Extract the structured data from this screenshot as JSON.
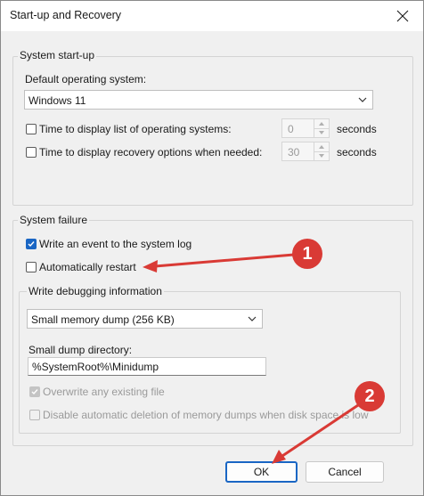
{
  "window": {
    "title": "Start-up and Recovery"
  },
  "startup": {
    "group_label": "System start-up",
    "default_os_label": "Default operating system:",
    "default_os_value": "Windows 11",
    "time_list_label": "Time to display list of operating systems:",
    "time_list_value": "0",
    "time_list_checked": false,
    "time_recovery_label": "Time to display recovery options when needed:",
    "time_recovery_value": "30",
    "time_recovery_checked": false,
    "seconds_label": "seconds"
  },
  "failure": {
    "group_label": "System failure",
    "write_event_label": "Write an event to the system log",
    "write_event_checked": true,
    "auto_restart_label": "Automatically restart",
    "auto_restart_checked": false,
    "debug_group_label": "Write debugging information",
    "debug_select_value": "Small memory dump (256 KB)",
    "dump_dir_label": "Small dump directory:",
    "dump_dir_value": "%SystemRoot%\\Minidump",
    "overwrite_label": "Overwrite any existing file",
    "overwrite_checked": true,
    "disable_delete_label": "Disable automatic deletion of memory dumps when disk space is low",
    "disable_delete_checked": false
  },
  "buttons": {
    "ok": "OK",
    "cancel": "Cancel"
  },
  "annotations": {
    "marker1": "1",
    "marker2": "2",
    "color": "#d93a35"
  },
  "colors": {
    "accent": "#1a66c4",
    "background": "#f0f0f0"
  }
}
